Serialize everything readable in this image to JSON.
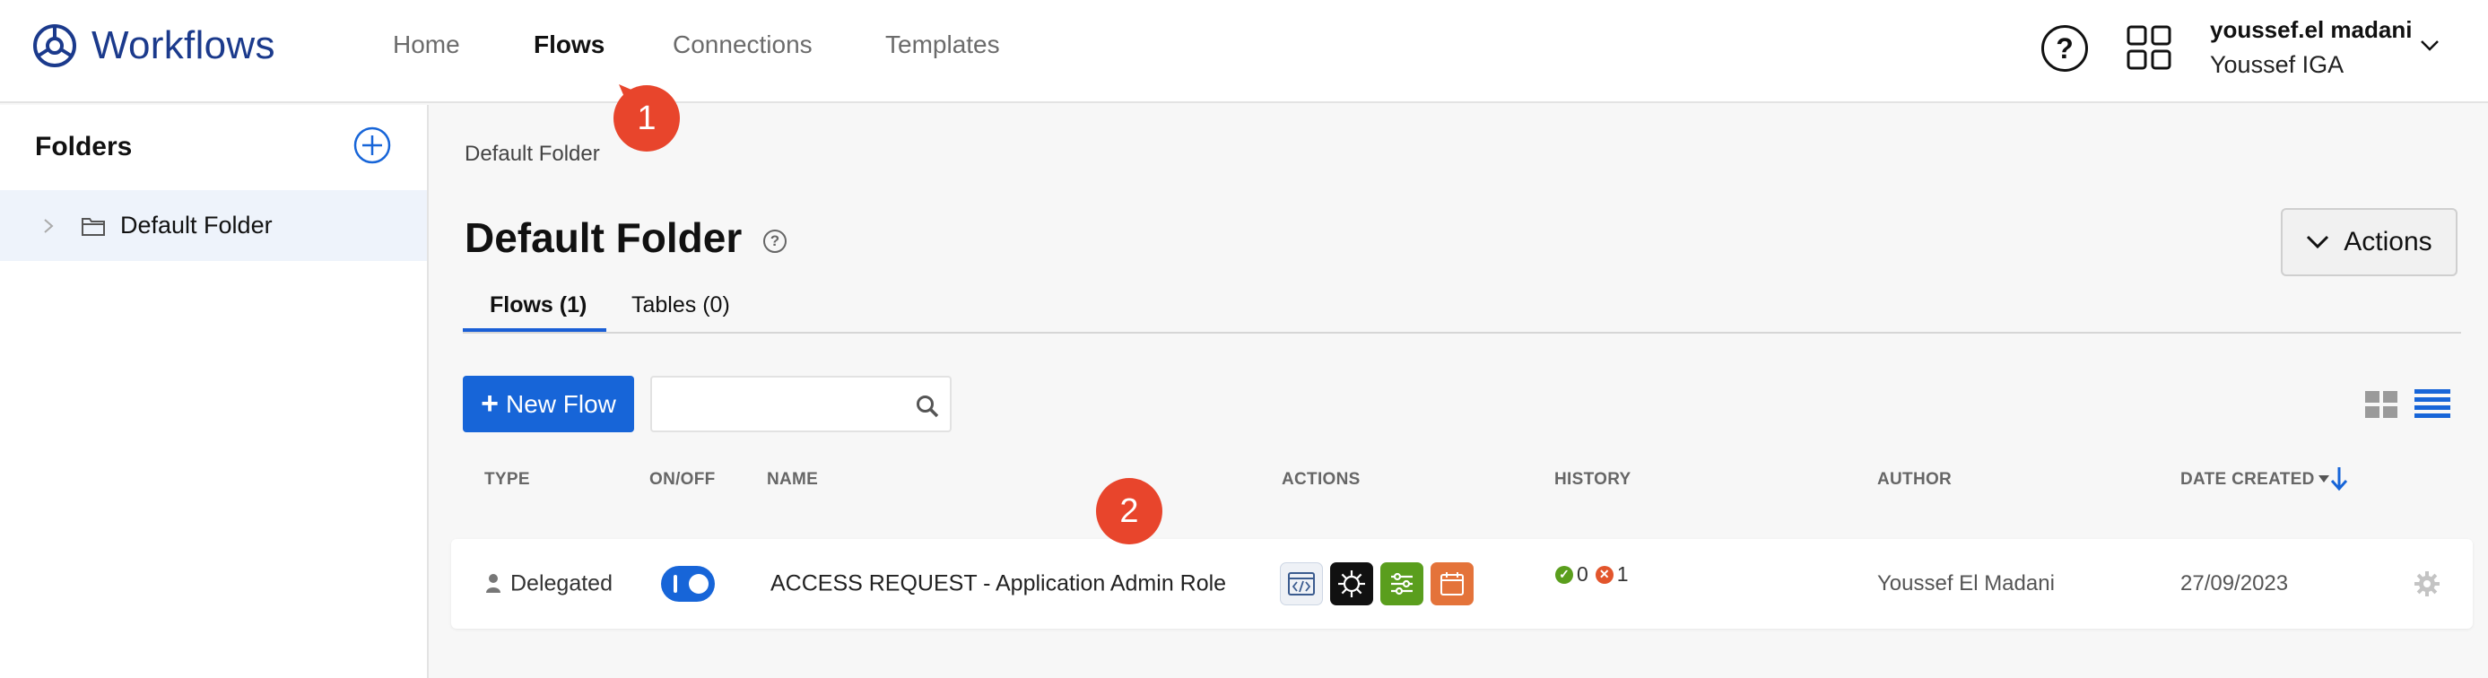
{
  "app": {
    "title": "Workflows"
  },
  "nav": {
    "home": "Home",
    "flows": "Flows",
    "connections": "Connections",
    "templates": "Templates"
  },
  "help": {
    "glyph": "?"
  },
  "user": {
    "name": "youssef.el madani",
    "org": "Youssef IGA"
  },
  "sidebar": {
    "title": "Folders",
    "items": [
      {
        "label": "Default Folder"
      }
    ]
  },
  "breadcrumb": "Default Folder",
  "page": {
    "title": "Default Folder",
    "actions_label": "Actions"
  },
  "tabs": [
    {
      "label": "Flows (1)",
      "active": true
    },
    {
      "label": "Tables (0)",
      "active": false
    }
  ],
  "toolbar": {
    "new_flow_label": "New Flow",
    "new_flow_icon": "+",
    "search_placeholder": ""
  },
  "table": {
    "headers": {
      "type": "TYPE",
      "onoff": "ON/OFF",
      "name": "NAME",
      "actions": "ACTIONS",
      "history": "HISTORY",
      "author": "AUTHOR",
      "date": "DATE CREATED"
    },
    "rows": [
      {
        "type": "Delegated",
        "enabled": true,
        "name": "ACCESS REQUEST - Application Admin Role",
        "action_icons": [
          "api-endpoint-icon",
          "okta-icon",
          "settings-sliders-icon",
          "calendar-icon"
        ],
        "history": {
          "success": "0",
          "failed": "1"
        },
        "author": "Youssef El Madani",
        "date": "27/09/2023"
      }
    ]
  },
  "callouts": [
    "1",
    "2"
  ],
  "colors": {
    "accent": "#1765d8",
    "brand": "#1b3a8c",
    "callout": "#e8452c",
    "success": "#5a9e1d",
    "error": "#e2552c"
  }
}
